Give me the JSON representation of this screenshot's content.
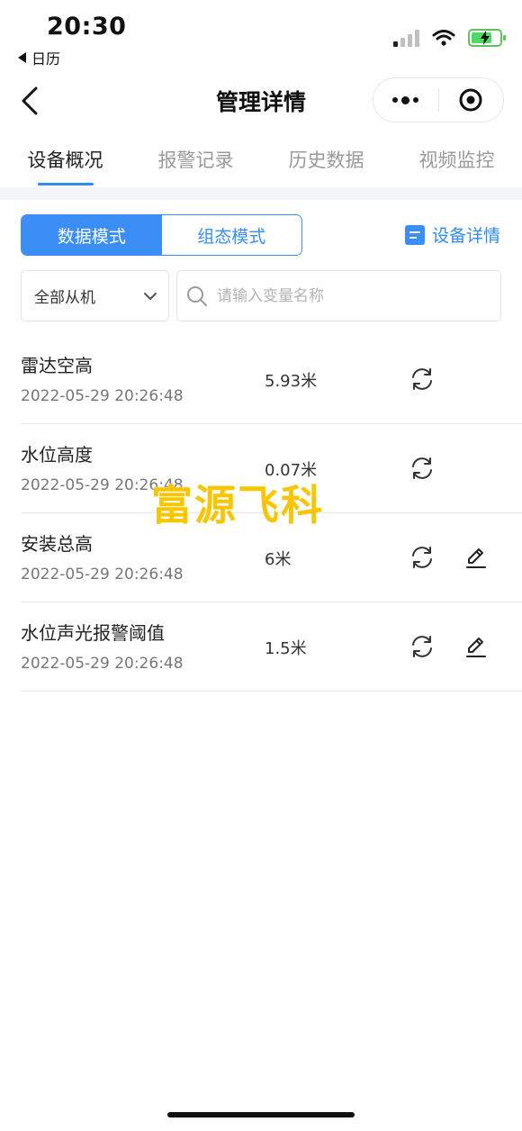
{
  "status_bar": {
    "time": "20:30",
    "back_app": "日历"
  },
  "nav": {
    "title": "管理详情"
  },
  "tabs": [
    {
      "label": "设备概况",
      "active": true
    },
    {
      "label": "报警记录",
      "active": false
    },
    {
      "label": "历史数据",
      "active": false
    },
    {
      "label": "视频监控",
      "active": false
    }
  ],
  "mode_toggle": {
    "data_mode": "数据模式",
    "config_mode": "组态模式",
    "selected": "数据模式"
  },
  "device_detail_link": "设备详情",
  "filter": {
    "selected": "全部从机"
  },
  "search": {
    "placeholder": "请输入变量名称",
    "value": ""
  },
  "variables": [
    {
      "name": "雷达空高",
      "timestamp": "2022-05-29 20:26:48",
      "value": "5.93米",
      "editable": false
    },
    {
      "name": "水位高度",
      "timestamp": "2022-05-29 20:26:48",
      "value": "0.07米",
      "editable": false
    },
    {
      "name": "安装总高",
      "timestamp": "2022-05-29 20:26:48",
      "value": "6米",
      "editable": true
    },
    {
      "name": "水位声光报警阈值",
      "timestamp": "2022-05-29 20:26:48",
      "value": "1.5米",
      "editable": true
    }
  ],
  "watermark": "富源飞科",
  "colors": {
    "accent": "#3a8ef6",
    "watermark": "#f7c600",
    "battery": "#4cd964"
  },
  "icons": [
    "back-chevron-icon",
    "more-dots-icon",
    "target-circle-icon",
    "document-icon",
    "chevron-down-icon",
    "search-icon",
    "refresh-icon",
    "pencil-edit-icon"
  ]
}
